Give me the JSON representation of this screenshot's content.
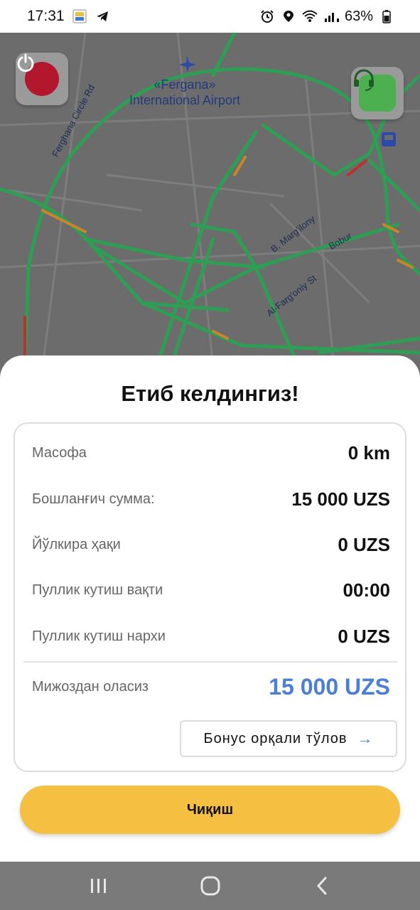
{
  "status_bar": {
    "time": "17:31",
    "battery": "63%",
    "icons": [
      "app-notification-icon",
      "telegram-icon",
      "alarm-icon",
      "location-icon",
      "wifi-icon",
      "signal-icon",
      "battery-icon"
    ]
  },
  "map": {
    "airport_line1": "«Fergana»",
    "airport_line2": "International Airport",
    "street_labels": {
      "circle_rd": "Ferghana Circle Rd",
      "margilony": "B. Marg'ilony",
      "bobur": "Bobur",
      "fargoniy": "Al-Farg'oniy St"
    },
    "power_button": "power-icon",
    "support_button": "headset-icon",
    "accent_red": "#b3172e",
    "accent_green": "#4caf50"
  },
  "sheet": {
    "title": "Етиб келдингиз!",
    "rows": [
      {
        "label": "Масофа",
        "value": "0 km"
      },
      {
        "label": "Бошланғич сумма:",
        "value": "15 000 UZS"
      },
      {
        "label": "Йўлкира ҳақи",
        "value": "0 UZS"
      },
      {
        "label": "Пуллик кутиш вақти",
        "value": "00:00"
      },
      {
        "label": "Пуллик кутиш нархи",
        "value": "0 UZS"
      }
    ],
    "total": {
      "label": "Мижоздан оласиз",
      "value": "15 000 UZS"
    },
    "bonus_button": "Бонус орқали тўлов",
    "exit_button": "Чиқиш",
    "accent_blue": "#4b7fd6",
    "accent_yellow": "#f5c041"
  },
  "nav_bar": {
    "buttons": [
      "recent-apps-icon",
      "home-icon",
      "back-icon"
    ]
  }
}
